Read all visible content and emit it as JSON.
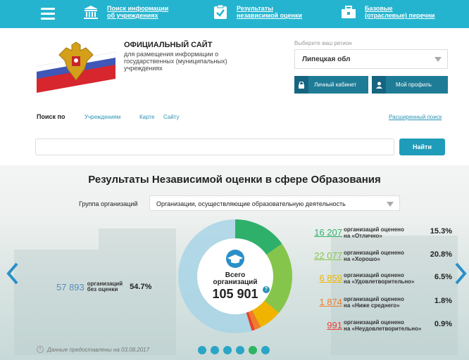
{
  "nav": {
    "items": [
      {
        "label_1": "Поиск информации",
        "label_2": "об учреждениях",
        "icon": "building-icon"
      },
      {
        "label_1": "Результаты",
        "label_2": "независимой оценки",
        "icon": "clipboard-check-icon"
      },
      {
        "label_1": "Базовые",
        "label_2": "(отраслевые) перечни",
        "icon": "briefcase-icon"
      }
    ]
  },
  "header": {
    "title": "ОФИЦИАЛЬНЫЙ САЙТ",
    "subtitle": "для размещения информации о государственных (муниципальных) учреждениях",
    "region_label": "Выберите ваш регион",
    "region_value": "Липецкая обл",
    "cabinet_btn": "Личный кабинет",
    "profile_btn": "Мой профиль"
  },
  "search": {
    "by_label": "Поиск по",
    "tabs": [
      "Учреждениям",
      "Карте",
      "Сайту"
    ],
    "advanced": "Расширенный поиск",
    "input_placeholder": "",
    "button": "Найти"
  },
  "results": {
    "title": "Результаты Независимой оценки в сфере Образования",
    "group_label": "Группа организаций",
    "group_value": "Организации, осуществляющие образовательную деятельность",
    "total_label_1": "Всего",
    "total_label_2": "организаций",
    "total_value": "105 901",
    "unrated": {
      "value": "57 893",
      "text_1": "организаций",
      "text_2": "без оценки",
      "pct": "54.7%"
    },
    "ratings": [
      {
        "value": "16 207",
        "text_1": "организаций оценено",
        "text_2": "на «Отлично»",
        "pct": "15.3%",
        "color": "#2fb06a"
      },
      {
        "value": "22 077",
        "text_1": "организаций оценено",
        "text_2": "на «Хорошо»",
        "pct": "20.8%",
        "color": "#86c54b"
      },
      {
        "value": "6 859",
        "text_1": "организаций оценено",
        "text_2": "на «Удовлетворительно»",
        "pct": "6.5%",
        "color": "#f0b400"
      },
      {
        "value": "1 874",
        "text_1": "организаций оценено",
        "text_2": "на «Ниже среднего»",
        "pct": "1.8%",
        "color": "#f07c2a"
      },
      {
        "value": "991",
        "text_1": "организаций оценено",
        "text_2": "на «Неудовлетворительно»",
        "pct": "0.9%",
        "color": "#e8402e"
      }
    ],
    "date_note": "Данные предоставлены на 03.08.2017",
    "slides": 6,
    "active_slide": 4
  }
}
